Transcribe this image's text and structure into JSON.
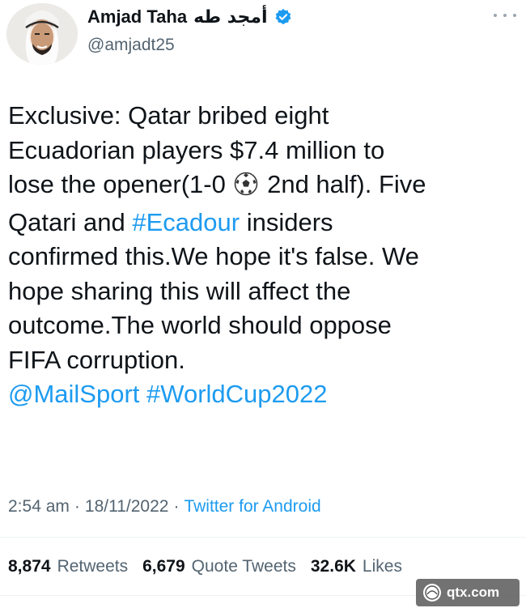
{
  "author": {
    "display_name": "Amjad Taha",
    "arabic_name": "أمجد طه",
    "handle": "@amjadt25",
    "verified": true
  },
  "tweet": {
    "line1": "Exclusive: Qatar bribed eight",
    "line2": "Ecuadorian players $7.4 million to",
    "line3_a": "lose the opener(1-0 ",
    "line3_emoji": "soccer-ball-emoji",
    "line3_b": " 2nd half). Five",
    "line4_a": "Qatari and ",
    "hashtag_ecadour": "#Ecadour",
    "line4_b": " insiders",
    "line5": "confirmed this.We hope it's false. We",
    "line6": "hope sharing this will affect the",
    "line7": "outcome.The world should oppose",
    "line8": "FIFA corruption.",
    "mention": "@MailSport",
    "hashtag_worldcup": "#WorldCup2022"
  },
  "meta": {
    "time": "2:54 am",
    "separator": "·",
    "date": "18/11/2022",
    "source": "Twitter for Android"
  },
  "stats": {
    "retweets_count": "8,874",
    "retweets_label": "Retweets",
    "quotes_count": "6,679",
    "quotes_label": "Quote Tweets",
    "likes_count": "32.6K",
    "likes_label": "Likes"
  },
  "watermark": {
    "text": "qtx.com"
  },
  "colors": {
    "link": "#1d9bf0",
    "secondary_text": "#536471",
    "primary_text": "#0f1419"
  }
}
